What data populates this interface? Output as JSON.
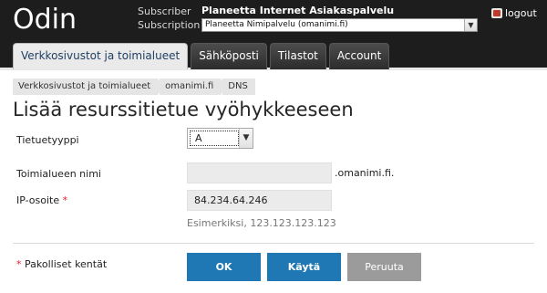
{
  "header": {
    "logo": "Odin",
    "subscriber_label": "Subscriber",
    "subscriber_value": "Planeetta Internet Asiakaspalvelu",
    "subscription_label": "Subscription",
    "subscription_value": "Planeetta Nimipalvelu (omanimi.fi)",
    "logout_label": "logout",
    "dropdown_arrow": "▼"
  },
  "tabs": [
    {
      "label": "Verkkosivustot ja toimialueet",
      "active": true
    },
    {
      "label": "Sähköposti",
      "active": false
    },
    {
      "label": "Tilastot",
      "active": false
    },
    {
      "label": "Account",
      "active": false
    }
  ],
  "breadcrumb": [
    "Verkkosivustot ja toimialueet",
    "omanimi.fi",
    "DNS"
  ],
  "page_title": "Lisää resurssitietue vyöhykkeeseen",
  "form": {
    "record_type_label": "Tietuetyyppi",
    "record_type_value": "A",
    "domain_label": "Toimialueen nimi",
    "domain_value": "",
    "domain_suffix": ".omanimi.fi.",
    "ip_label": "IP-osoite",
    "required_mark": "*",
    "ip_value": "84.234.64.246",
    "ip_hint": "Esimerkiksi, 123.123.123.123",
    "required_note": "Pakolliset kentät",
    "ok_label": "OK",
    "apply_label": "Käytä",
    "cancel_label": "Peruuta"
  },
  "colors": {
    "header_bg": "#1d1d1d",
    "primary_button": "#1f78b4",
    "cancel_button": "#9b9b9b",
    "required": "#e8192c"
  }
}
